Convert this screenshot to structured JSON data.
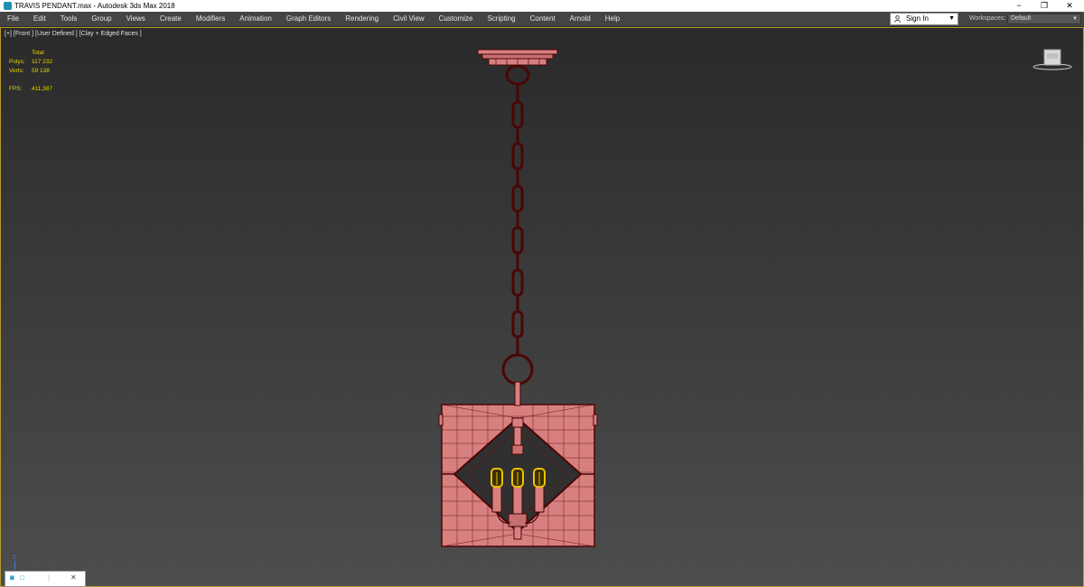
{
  "window": {
    "title": "TRAVIS PENDANT.max - Autodesk 3ds Max 2018",
    "minimize": "−",
    "restore": "❐",
    "close": "✕"
  },
  "menu": [
    "File",
    "Edit",
    "Tools",
    "Group",
    "Views",
    "Create",
    "Modifiers",
    "Animation",
    "Graph Editors",
    "Rendering",
    "Civil View",
    "Customize",
    "Scripting",
    "Content",
    "Arnold",
    "Help"
  ],
  "account": {
    "sign_in": "Sign In",
    "workspaces_label": "Workspaces:",
    "workspace": "Default"
  },
  "viewport": {
    "label": "[+] [Front ] [User Defined ] [Clay + Edged Faces ]",
    "stats": {
      "header": "Total",
      "polys_label": "Polys:",
      "polys": "117 232",
      "verts_label": "Verts:",
      "verts": "59 138",
      "fps_label": "FPS:",
      "fps": "411,387"
    },
    "axis_label": "Z"
  },
  "colors": {
    "accent": "#e8d200",
    "model": "#d88080",
    "wire": "#4a0606",
    "bulb": "#f0c000"
  },
  "icons": [
    "app-icon",
    "user-icon",
    "nav-cube",
    "axis-tripod"
  ]
}
